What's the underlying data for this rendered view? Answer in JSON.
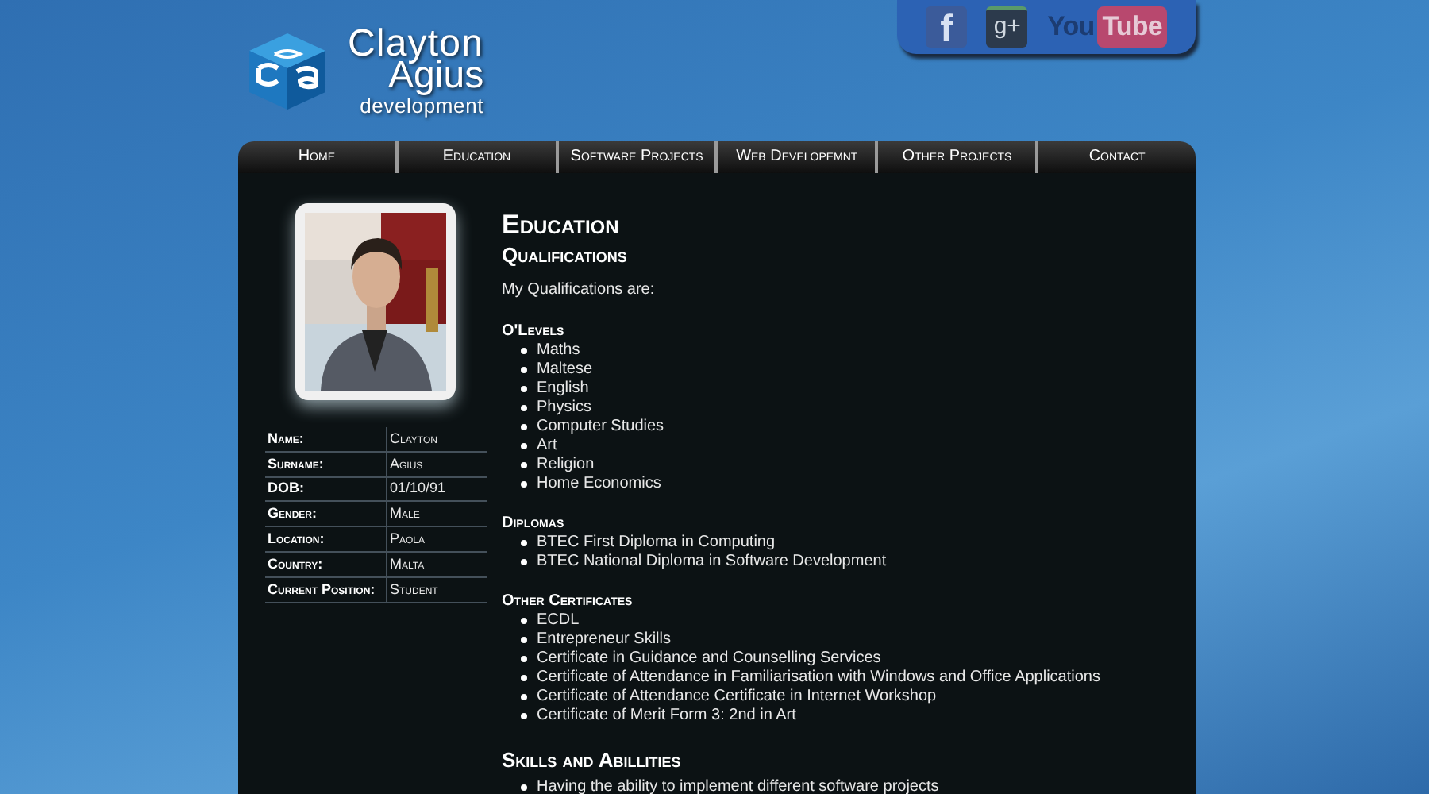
{
  "logo": {
    "line1": "Clayton",
    "line2": "Agius",
    "line3": "development"
  },
  "social": [
    {
      "kind": "facebook",
      "label": "f"
    },
    {
      "kind": "googleplus",
      "label": "g+"
    },
    {
      "kind": "youtube",
      "label": "You",
      "label2": "Tube"
    }
  ],
  "nav": [
    "Home",
    "Education",
    "Software Projects",
    "Web Developemnt",
    "Other Projects",
    "Contact"
  ],
  "profile": {
    "rows": [
      {
        "label": "Name:",
        "value": "Clayton"
      },
      {
        "label": "Surname:",
        "value": "Agius"
      },
      {
        "label": "DOB:",
        "value": "01/10/91"
      },
      {
        "label": "Gender:",
        "value": "Male"
      },
      {
        "label": "Location:",
        "value": "Paola"
      },
      {
        "label": "Country:",
        "value": "Malta"
      },
      {
        "label": "Current Position:",
        "value": "Student"
      }
    ]
  },
  "content": {
    "title": "Education",
    "subtitle": "Qualifications",
    "intro": "My Qualifications are:",
    "sections": [
      {
        "heading": "O'Levels",
        "items": [
          "Maths",
          "Maltese",
          "English",
          "Physics",
          "Computer Studies",
          "Art",
          "Religion",
          "Home Economics"
        ]
      },
      {
        "heading": "Diplomas",
        "items": [
          "BTEC First Diploma in Computing",
          "BTEC National Diploma in Software Development"
        ]
      },
      {
        "heading": "Other Certificates",
        "items": [
          "ECDL",
          "Entrepreneur Skills",
          "Certificate in Guidance and Counselling Services",
          "Certificate of Attendance in Familiarisation with Windows and Office Applications",
          "Certificate of Attendance Certificate in Internet Workshop",
          "Certificate of Merit Form 3: 2nd in Art"
        ]
      }
    ],
    "skills_title": "Skills and Abillities",
    "skills": [
      "Having the ability to implement different software projects"
    ]
  }
}
